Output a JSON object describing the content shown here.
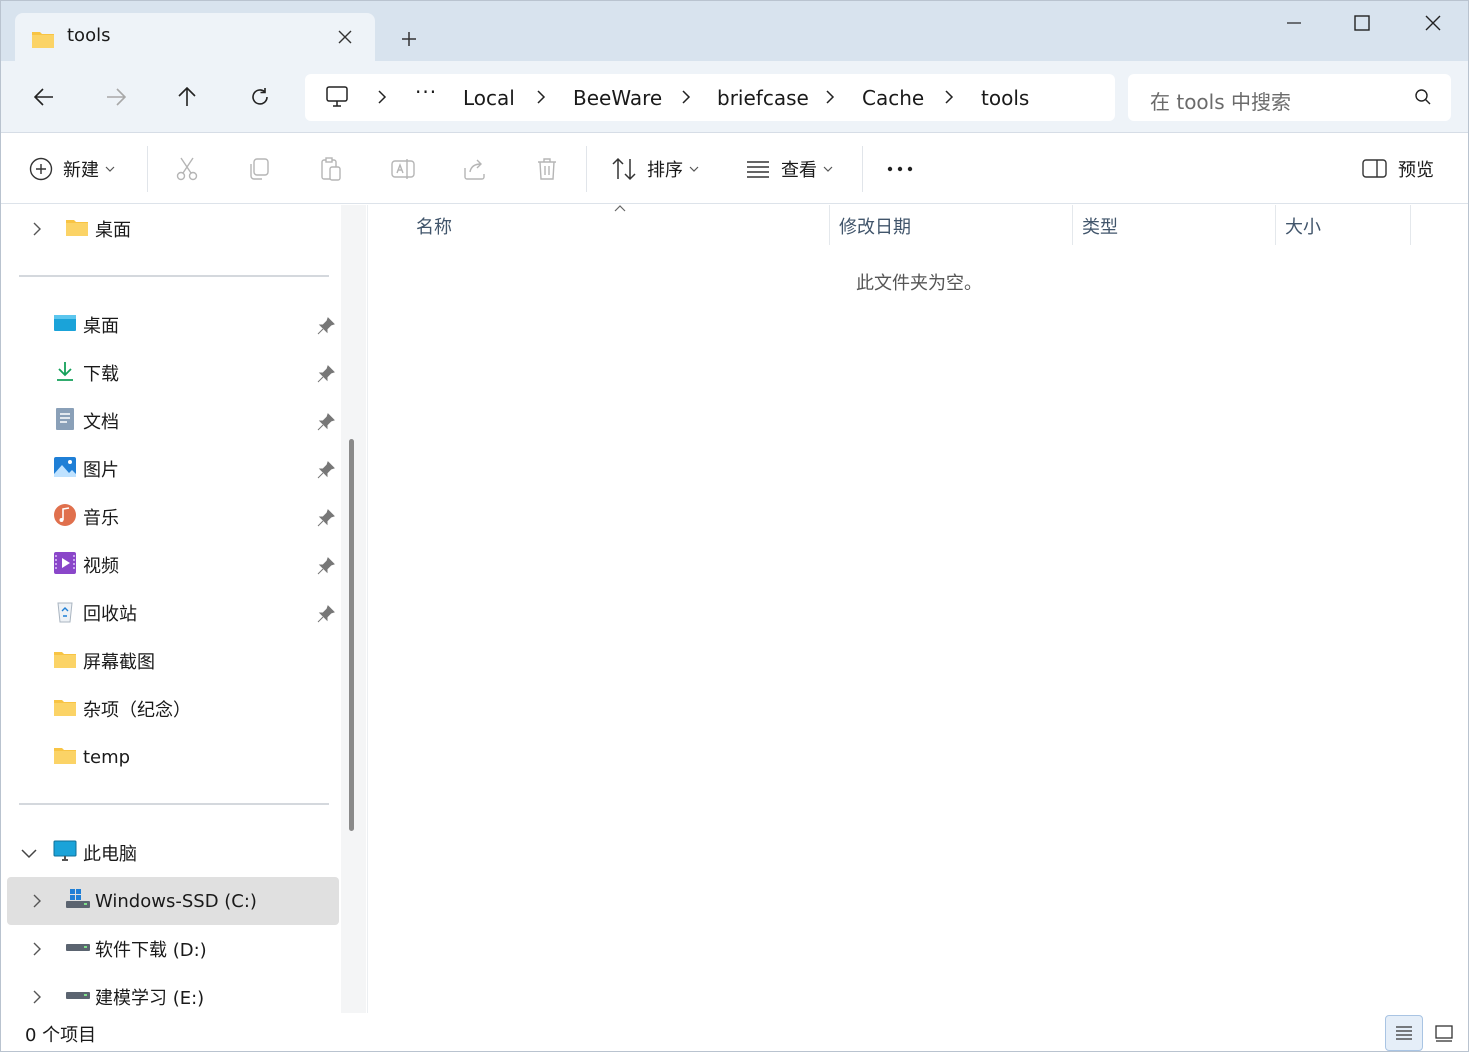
{
  "tab": {
    "title": "tools"
  },
  "address": {
    "crumbs": [
      "Local",
      "BeeWare",
      "briefcase",
      "Cache",
      "tools"
    ],
    "more": "···"
  },
  "search": {
    "placeholder": "在 tools 中搜索"
  },
  "commands": {
    "new_label": "新建",
    "sort_label": "排序",
    "view_label": "查看",
    "more_label": "•••",
    "preview_label": "预览"
  },
  "sidebar": {
    "top_item": "桌面",
    "quick_access": [
      {
        "label": "桌面",
        "icon": "desktop-icon",
        "pinned": true
      },
      {
        "label": "下载",
        "icon": "download-icon",
        "pinned": true
      },
      {
        "label": "文档",
        "icon": "document-icon",
        "pinned": true
      },
      {
        "label": "图片",
        "icon": "pictures-icon",
        "pinned": true
      },
      {
        "label": "音乐",
        "icon": "music-icon",
        "pinned": true
      },
      {
        "label": "视频",
        "icon": "videos-icon",
        "pinned": true
      },
      {
        "label": "回收站",
        "icon": "recycle-bin-icon",
        "pinned": true
      },
      {
        "label": "屏幕截图",
        "icon": "folder-icon",
        "pinned": false
      },
      {
        "label": "杂项（纪念）",
        "icon": "folder-icon",
        "pinned": false
      },
      {
        "label": "temp",
        "icon": "folder-icon",
        "pinned": false
      }
    ],
    "this_pc": "此电脑",
    "drives": [
      {
        "label": "Windows-SSD (C:)",
        "selected": true
      },
      {
        "label": "软件下载 (D:)",
        "selected": false
      },
      {
        "label": "建模学习 (E:)",
        "selected": false
      }
    ]
  },
  "columns": [
    "名称",
    "修改日期",
    "类型",
    "大小"
  ],
  "empty_message": "此文件夹为空。",
  "status": {
    "item_count": "0 个项目"
  },
  "colors": {
    "titlebar": "#d8e3ee",
    "navbar": "#eef3f8",
    "folder": "#f8c444",
    "accent": "#0067c0"
  }
}
